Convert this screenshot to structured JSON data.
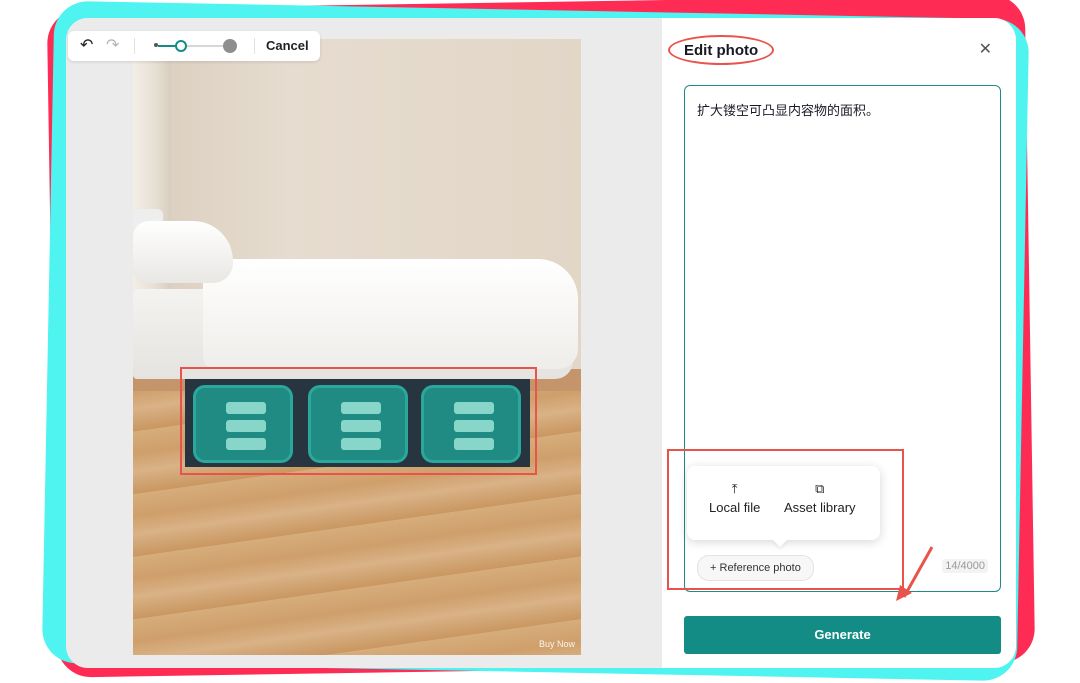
{
  "toolbar": {
    "undo_icon": "undo-icon",
    "redo_icon": "redo-icon",
    "brush_size_slider_value": 0.35,
    "cancel_label": "Cancel"
  },
  "canvas": {
    "photo_overlay_text": "Buy Now"
  },
  "panel": {
    "title": "Edit photo",
    "close_icon": "close-icon",
    "prompt_text": "扩大镂空可凸显内容物的面积。",
    "char_counter": "14/4000",
    "popover": {
      "items": [
        {
          "label": "Local file",
          "icon": "upload-icon"
        },
        {
          "label": "Asset library",
          "icon": "asset-library-icon"
        }
      ]
    },
    "reference_photo_label": "Reference photo",
    "generate_label": "Generate"
  },
  "colors": {
    "accent": "#138c86",
    "annotation_red": "#e8544c",
    "frame_red": "#fe2c55",
    "frame_cyan": "#4ff3f0"
  }
}
